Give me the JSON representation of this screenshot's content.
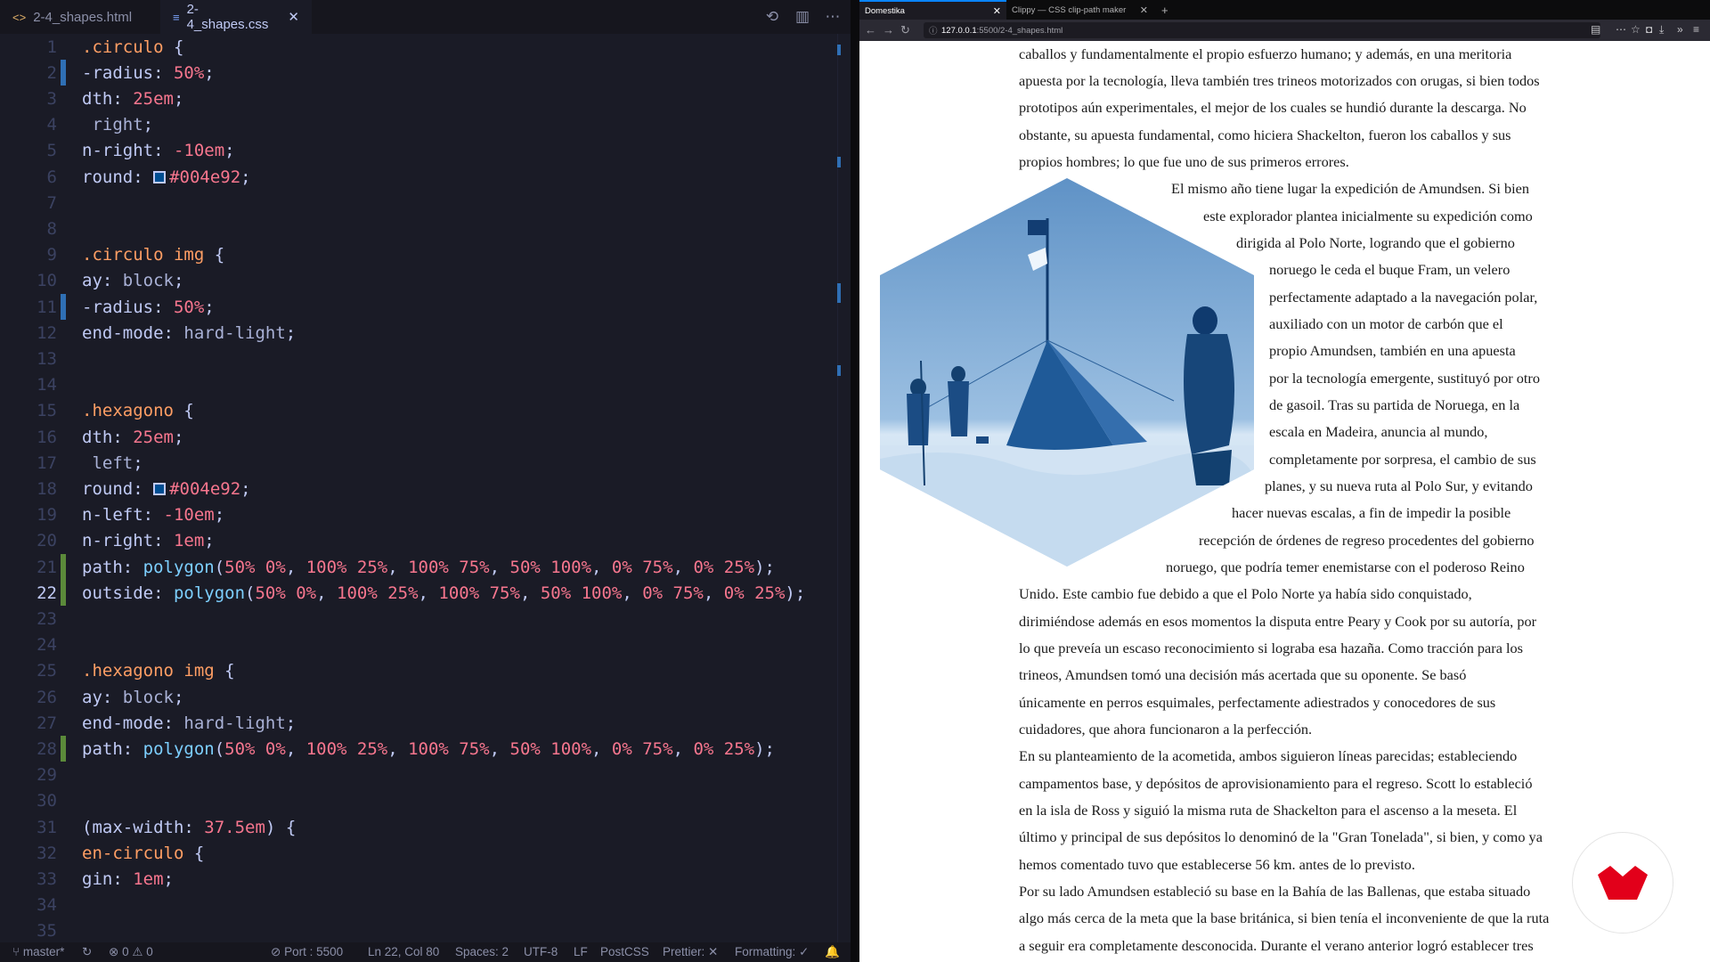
{
  "editor": {
    "tabs": [
      {
        "label": "2-4_shapes.html",
        "icon": "<>",
        "active": false
      },
      {
        "label": "2-4_shapes.css",
        "icon": "≡",
        "active": true
      }
    ],
    "lines": [
      {
        "n": "1",
        "tokens": [
          [
            "sel",
            ".circulo "
          ],
          [
            "pun",
            "{"
          ]
        ]
      },
      {
        "n": "2",
        "gutter": "blue",
        "tokens": [
          [
            "prop",
            "-radius: "
          ],
          [
            "num",
            "50%"
          ],
          [
            "pun",
            ";"
          ]
        ]
      },
      {
        "n": "3",
        "tokens": [
          [
            "prop",
            "dth: "
          ],
          [
            "num",
            "25em"
          ],
          [
            "pun",
            ";"
          ]
        ]
      },
      {
        "n": "4",
        "tokens": [
          [
            "key",
            " right"
          ],
          [
            "pun",
            ";"
          ]
        ]
      },
      {
        "n": "5",
        "tokens": [
          [
            "prop",
            "n-right: "
          ],
          [
            "num",
            "-10em"
          ],
          [
            "pun",
            ";"
          ]
        ]
      },
      {
        "n": "6",
        "tokens": [
          [
            "prop",
            "round: "
          ],
          [
            "swatch",
            ""
          ],
          [
            "num",
            "#004e92"
          ],
          [
            "pun",
            ";"
          ]
        ]
      },
      {
        "n": "7",
        "tokens": []
      },
      {
        "n": "8",
        "tokens": []
      },
      {
        "n": "9",
        "tokens": [
          [
            "sel",
            ".circulo img "
          ],
          [
            "pun",
            "{"
          ]
        ]
      },
      {
        "n": "10",
        "tokens": [
          [
            "prop",
            "ay: "
          ],
          [
            "key",
            "block"
          ],
          [
            "pun",
            ";"
          ]
        ]
      },
      {
        "n": "11",
        "gutter": "blue",
        "tokens": [
          [
            "prop",
            "-radius: "
          ],
          [
            "num",
            "50%"
          ],
          [
            "pun",
            ";"
          ]
        ]
      },
      {
        "n": "12",
        "tokens": [
          [
            "prop",
            "end-mode: "
          ],
          [
            "key",
            "hard-light"
          ],
          [
            "pun",
            ";"
          ]
        ]
      },
      {
        "n": "13",
        "tokens": []
      },
      {
        "n": "14",
        "tokens": []
      },
      {
        "n": "15",
        "tokens": [
          [
            "sel",
            ".hexagono "
          ],
          [
            "pun",
            "{"
          ]
        ]
      },
      {
        "n": "16",
        "tokens": [
          [
            "prop",
            "dth: "
          ],
          [
            "num",
            "25em"
          ],
          [
            "pun",
            ";"
          ]
        ]
      },
      {
        "n": "17",
        "tokens": [
          [
            "key",
            " left"
          ],
          [
            "pun",
            ";"
          ]
        ]
      },
      {
        "n": "18",
        "tokens": [
          [
            "prop",
            "round: "
          ],
          [
            "swatch",
            ""
          ],
          [
            "num",
            "#004e92"
          ],
          [
            "pun",
            ";"
          ]
        ]
      },
      {
        "n": "19",
        "tokens": [
          [
            "prop",
            "n-left: "
          ],
          [
            "num",
            "-10em"
          ],
          [
            "pun",
            ";"
          ]
        ]
      },
      {
        "n": "20",
        "tokens": [
          [
            "prop",
            "n-right: "
          ],
          [
            "num",
            "1em"
          ],
          [
            "pun",
            ";"
          ]
        ]
      },
      {
        "n": "21",
        "gutter": "green",
        "tokens": [
          [
            "prop",
            "path: "
          ],
          [
            "fn",
            "polygon"
          ],
          [
            "pun",
            "("
          ],
          [
            "num",
            "50% 0%"
          ],
          [
            "pun",
            ", "
          ],
          [
            "num",
            "100% 25%"
          ],
          [
            "pun",
            ", "
          ],
          [
            "num",
            "100% 75%"
          ],
          [
            "pun",
            ", "
          ],
          [
            "num",
            "50% 100%"
          ],
          [
            "pun",
            ", "
          ],
          [
            "num",
            "0% 75%"
          ],
          [
            "pun",
            ", "
          ],
          [
            "num",
            "0% 25%"
          ],
          [
            "pun",
            ");"
          ]
        ]
      },
      {
        "n": "22",
        "gutter": "green",
        "current": true,
        "tokens": [
          [
            "prop",
            "outside: "
          ],
          [
            "fn",
            "polygon"
          ],
          [
            "pun",
            "("
          ],
          [
            "num",
            "50% 0%"
          ],
          [
            "pun",
            ", "
          ],
          [
            "num",
            "100% 25%"
          ],
          [
            "pun",
            ", "
          ],
          [
            "num",
            "100% 75%"
          ],
          [
            "pun",
            ", "
          ],
          [
            "num",
            "50% 100%"
          ],
          [
            "pun",
            ", "
          ],
          [
            "num",
            "0% 75%"
          ],
          [
            "pun",
            ", "
          ],
          [
            "num",
            "0% 25%"
          ],
          [
            "pun",
            ");"
          ]
        ]
      },
      {
        "n": "23",
        "tokens": []
      },
      {
        "n": "24",
        "tokens": []
      },
      {
        "n": "25",
        "tokens": [
          [
            "sel",
            ".hexagono img "
          ],
          [
            "pun",
            "{"
          ]
        ]
      },
      {
        "n": "26",
        "tokens": [
          [
            "prop",
            "ay: "
          ],
          [
            "key",
            "block"
          ],
          [
            "pun",
            ";"
          ]
        ]
      },
      {
        "n": "27",
        "tokens": [
          [
            "prop",
            "end-mode: "
          ],
          [
            "key",
            "hard-light"
          ],
          [
            "pun",
            ";"
          ]
        ]
      },
      {
        "n": "28",
        "gutter": "green",
        "tokens": [
          [
            "prop",
            "path: "
          ],
          [
            "fn",
            "polygon"
          ],
          [
            "pun",
            "("
          ],
          [
            "num",
            "50% 0%"
          ],
          [
            "pun",
            ", "
          ],
          [
            "num",
            "100% 25%"
          ],
          [
            "pun",
            ", "
          ],
          [
            "num",
            "100% 75%"
          ],
          [
            "pun",
            ", "
          ],
          [
            "num",
            "50% 100%"
          ],
          [
            "pun",
            ", "
          ],
          [
            "num",
            "0% 75%"
          ],
          [
            "pun",
            ", "
          ],
          [
            "num",
            "0% 25%"
          ],
          [
            "pun",
            ");"
          ]
        ]
      },
      {
        "n": "29",
        "tokens": []
      },
      {
        "n": "30",
        "tokens": []
      },
      {
        "n": "31",
        "tokens": [
          [
            "pun",
            "("
          ],
          [
            "prop",
            "max-width: "
          ],
          [
            "num",
            "37.5em"
          ],
          [
            "pun",
            ") {"
          ]
        ]
      },
      {
        "n": "32",
        "tokens": [
          [
            "sel",
            "en-circulo "
          ],
          [
            "pun",
            "{"
          ]
        ]
      },
      {
        "n": "33",
        "tokens": [
          [
            "prop",
            "gin: "
          ],
          [
            "num",
            "1em"
          ],
          [
            "pun",
            ";"
          ]
        ]
      },
      {
        "n": "34",
        "tokens": []
      },
      {
        "n": "35",
        "tokens": []
      }
    ],
    "status": {
      "branch": "master*",
      "errors": "0",
      "warnings": "0",
      "port": "Port : 5500",
      "position": "Ln 22, Col 80",
      "spaces": "Spaces: 2",
      "encoding": "UTF-8",
      "eol": "LF",
      "language": "PostCSS",
      "prettier": "Prettier: ✕",
      "formatting": "Formatting: ✓"
    }
  },
  "browser": {
    "tabs": [
      {
        "label": "Domestika",
        "active": true
      },
      {
        "label": "Clippy — CSS clip-path maker",
        "active": false
      }
    ],
    "url_host": "127.0.0.1",
    "url_path": ":5500/2-4_shapes.html",
    "paragraphs": [
      "caballos y fundamentalmente el propio esfuerzo humano; y además, en una meritoria",
      "apuesta por la tecnología, lleva también tres trineos motorizados con orugas, si bien todos",
      "prototipos aún experimentales, el mejor de los cuales se hundió durante la descarga. No",
      "obstante, su apuesta fundamental, como hiciera Shackelton, fueron los caballos y sus",
      "propios hombres; lo que fue uno de sus primeros errores.",
      "El mismo año tiene lugar la expedición de Amundsen. Si bien",
      "este explorador plantea inicialmente su expedición como",
      "dirigida al Polo Norte, logrando que el gobierno",
      "noruego le ceda el buque Fram, un velero",
      "perfectamente adaptado a la navegación polar,",
      "auxiliado con un motor de carbón que el",
      "propio Amundsen, también en una apuesta",
      "por la tecnología emergente, sustituyó por otro",
      "de gasoil. Tras su partida de Noruega, en la",
      "escala en Madeira, anuncia al mundo,",
      "completamente por sorpresa, el cambio de sus",
      "planes, y su nueva ruta al Polo Sur, y evitando",
      "hacer nuevas escalas, a fin de impedir la posible",
      "recepción de órdenes de regreso procedentes del gobierno",
      "noruego, que podría temer enemistarse con el poderoso Reino",
      "Unido. Este cambio fue debido a que el Polo Norte ya había sido conquistado,",
      "dirimiéndose además en esos momentos la disputa entre Peary y Cook por su autoría, por",
      "lo que preveía un escaso reconocimiento si lograba esa hazaña. Como tracción para los",
      "trineos, Amundsen tomó una decisión más acertada que su oponente. Se basó",
      "únicamente en perros esquimales, perfectamente adiestrados y conocedores de sus",
      "cuidadores, que ahora funcionaron a la perfección.",
      "En su planteamiento de la acometida, ambos siguieron líneas parecidas; estableciendo",
      "campamentos base, y depósitos de aprovisionamiento para el regreso. Scott lo estableció",
      "en la isla de Ross y siguió la misma ruta de Shackelton para el ascenso a la meseta. El",
      "último y principal de sus depósitos lo denominó de la \"Gran Tonelada\", si bien, y como ya",
      "hemos comentado tuvo que establecerse 56 km. antes de lo previsto.",
      "Por su lado Amundsen estableció su base en la Bahía de las Ballenas, que estaba situado",
      "algo más cerca de la meta que la base británica, si bien tenía el inconveniente de que la ruta",
      "a seguir era completamente desconocida. Durante el verano anterior logró establecer tres"
    ]
  },
  "colors": {
    "editor_bg": "#1a1b26",
    "hex_bg": "#004e92",
    "domestika_red": "#e2001a"
  }
}
